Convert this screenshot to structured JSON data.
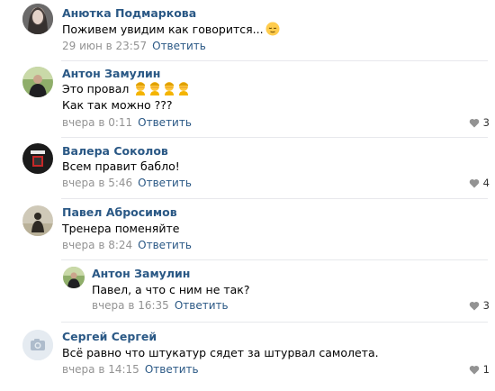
{
  "comments": [
    {
      "author": "Анютка Подмаркова",
      "text": "Поживем увидим как говорится...",
      "emoji": "relieved-face-emoji",
      "date": "29 июн в 23:57",
      "reply_label": "Ответить",
      "likes": null
    },
    {
      "author": "Антон Замулин",
      "text_line1": "Это провал",
      "emoji": "person-facepalm-emoji",
      "emoji_count": 4,
      "text_line2": "Как так можно ???",
      "date": "вчера в 0:11",
      "reply_label": "Ответить",
      "likes": "3"
    },
    {
      "author": "Валера Соколов",
      "text": "Всем правит бабло!",
      "date": "вчера в 5:46",
      "reply_label": "Ответить",
      "likes": "4"
    },
    {
      "author": "Павел Абросимов",
      "text": "Тренера поменяйте",
      "date": "вчера в 8:24",
      "reply_label": "Ответить",
      "likes": null,
      "replies": [
        {
          "author": "Антон Замулин",
          "text": "Павел, а что с ним не так?",
          "date": "вчера в 16:35",
          "reply_label": "Ответить",
          "likes": "3"
        }
      ]
    },
    {
      "author": "Сергей Сергей",
      "text": "Всё равно что штукатур сядет за штурвал самолета.",
      "avatar": "camera-placeholder-icon",
      "date": "вчера в 14:15",
      "reply_label": "Ответить",
      "likes": "1"
    }
  ],
  "colors": {
    "author": "#2a5885",
    "date": "#939393",
    "divider": "#e7e8ec",
    "like_icon": "#939393"
  }
}
